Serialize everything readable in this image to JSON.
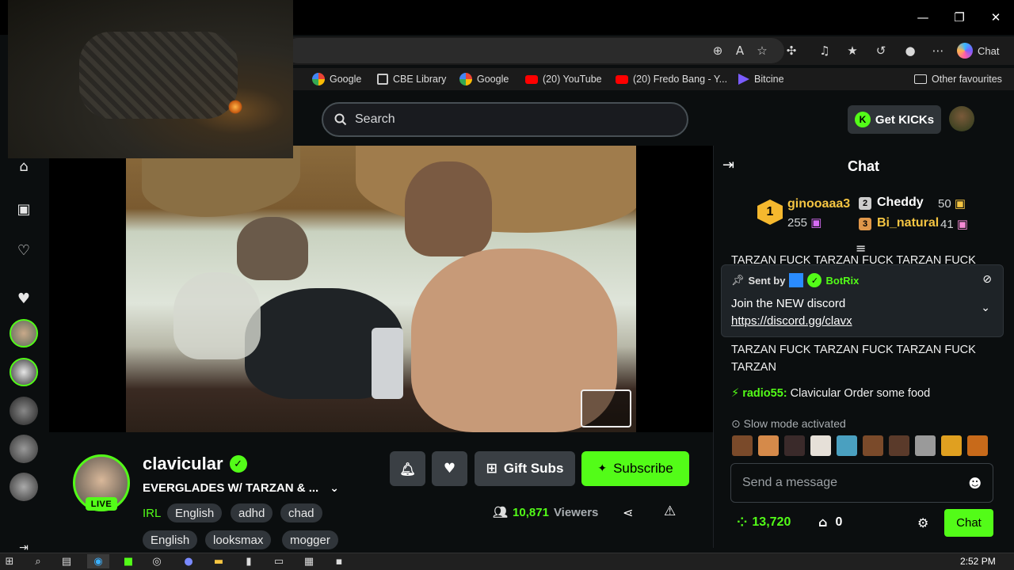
{
  "browser": {
    "window_controls": {
      "minimize": "—",
      "maximize": "❐",
      "close": "✕"
    },
    "copilot_label": "Chat",
    "favorites": [
      {
        "label": "Google",
        "icon": "google-icon"
      },
      {
        "label": "CBE Library",
        "icon": "library-icon"
      },
      {
        "label": "Google",
        "icon": "google-icon"
      },
      {
        "label": "(20) YouTube",
        "icon": "youtube-icon"
      },
      {
        "label": "(20) Fredo Bang - Y...",
        "icon": "youtube-icon"
      },
      {
        "label": "Bitcine",
        "icon": "bitcine-icon"
      }
    ],
    "other_favourites": "Other favourites"
  },
  "header": {
    "search_placeholder": "Search",
    "get_kicks": "Get KICKs"
  },
  "stream": {
    "streamer": "clavicular",
    "live_badge": "LIVE",
    "title": "EVERGLADES W/ TARZAN & ...",
    "category": "IRL",
    "tags_row1": [
      "English",
      "adhd",
      "chad"
    ],
    "tags_row2": [
      "English",
      "looksmax",
      "mogger"
    ],
    "viewers_count": "10,871",
    "viewers_label": "Viewers",
    "gift_subs": "Gift Subs",
    "subscribe": "Subscribe"
  },
  "chat": {
    "title": "Chat",
    "leaderboard": [
      {
        "rank": "1",
        "name": "ginooaaa3",
        "count": "255",
        "color": "#f5c542"
      },
      {
        "rank": "2",
        "name": "Cheddy",
        "count": "50",
        "color": "#ffffff"
      },
      {
        "rank": "3",
        "name": "Bi_natural",
        "count": "41",
        "color": "#f5c542"
      }
    ],
    "truncated_line": "TARZAN FUCK TARZAN FUCK TARZAN FUCK",
    "pinned": {
      "sent_by": "Sent by",
      "bot_name": "BotRix",
      "line1": "Join the NEW discord",
      "link": "https://discord.gg/clavx"
    },
    "messages": [
      {
        "text": "TARZAN FUCK TARZAN FUCK TARZAN FUCK TARZAN"
      },
      {
        "user": "radio55:",
        "text": " Clavicular Order some food",
        "user_color": "#53fc18"
      }
    ],
    "slow_mode": "Slow mode activated",
    "input_placeholder": "Send a message",
    "points": "13,720",
    "shop_count": "0",
    "send_label": "Chat"
  },
  "taskbar": {
    "time": "2:52 PM"
  },
  "colors": {
    "accent": "#53fc18",
    "background": "#0b0e0f",
    "button": "#3a3f44"
  }
}
